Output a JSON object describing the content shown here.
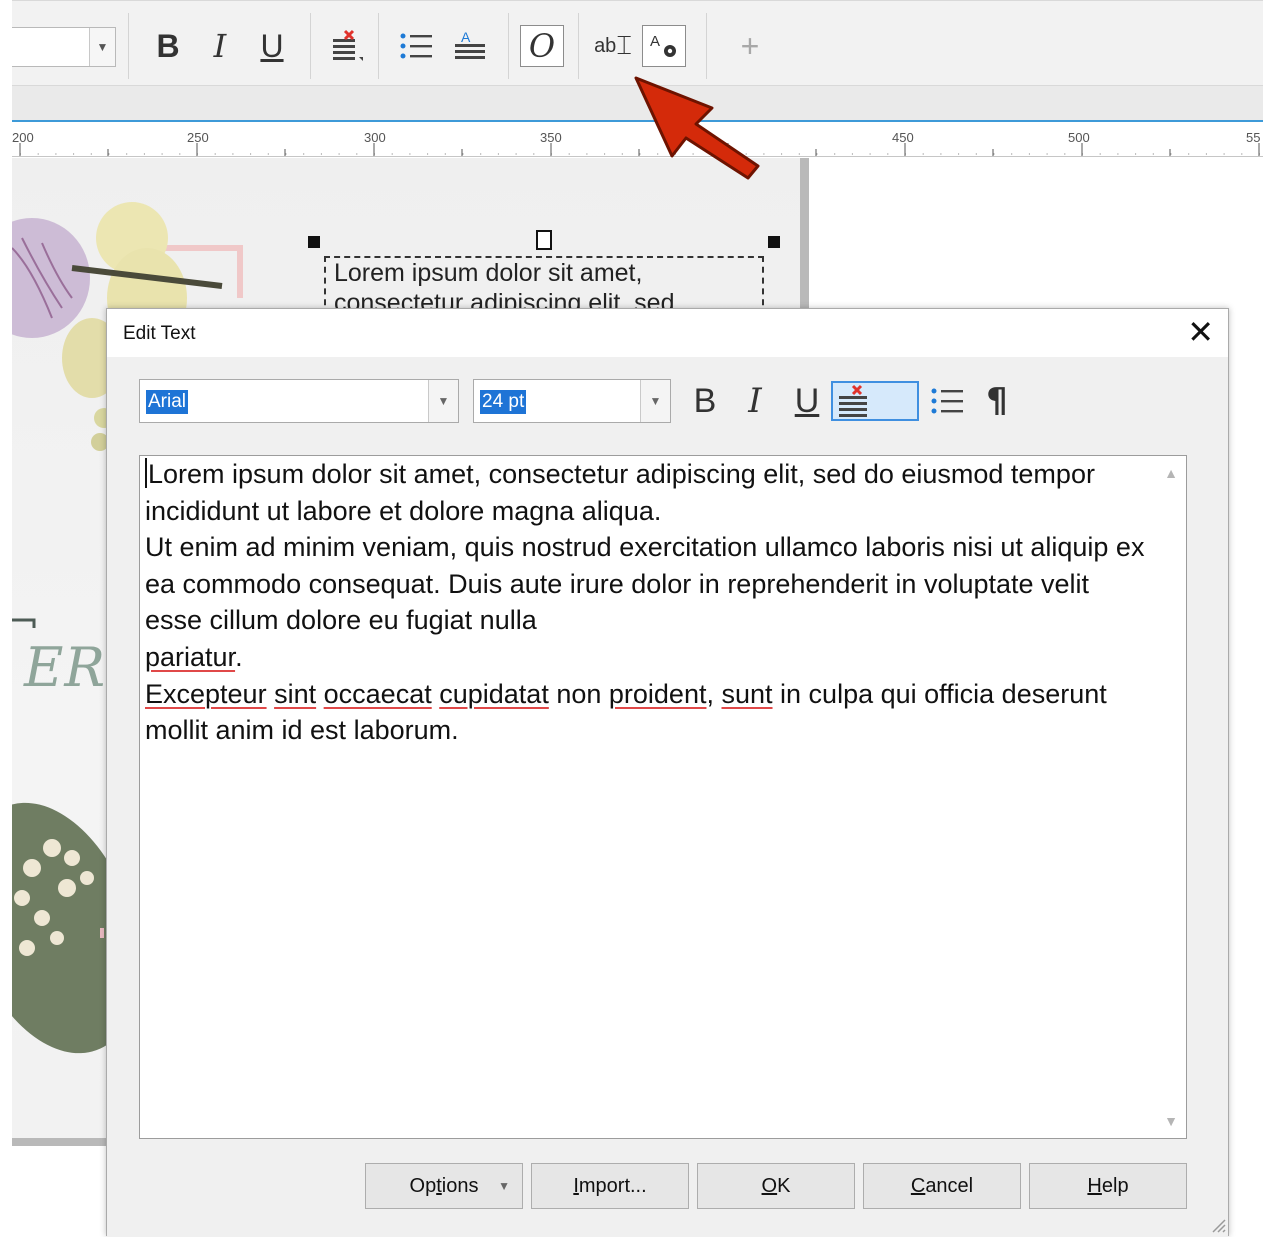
{
  "toolbar": {
    "font_combo_value": "",
    "bold_label": "B",
    "italic_label": "I",
    "underline_label": "U",
    "italic_style_label": "O",
    "text_tool_label": "ab",
    "text_settings_label": "A",
    "add_label": "+",
    "icons": [
      "chevron-down-icon",
      "clear-format-icon",
      "bullet-list-icon",
      "text-highlight-icon",
      "italic-style-icon",
      "edit-text-icon",
      "text-properties-icon",
      "plus-icon"
    ]
  },
  "ruler": {
    "labels": [
      "200",
      "250",
      "300",
      "350",
      "450",
      "500",
      "55"
    ]
  },
  "canvas": {
    "decorative_text": "ER",
    "frame_text": "Lorem ipsum dolor sit amet, consectetur adipiscing elit, sed"
  },
  "annotation": {
    "arrow_color": "#cc2200"
  },
  "dialog": {
    "title": "Edit Text",
    "close_label": "✕",
    "font_value": "Arial",
    "size_value": "24 pt",
    "bold_label": "B",
    "italic_label": "I",
    "underline_label": "U",
    "paragraph_label": "¶",
    "text": {
      "para1": "Lorem ipsum dolor sit amet, consectetur adipiscing elit, sed do eiusmod tempor incididunt ut labore et dolore magna aliqua.",
      "para2": "Ut enim ad minim veniam, quis nostrud exercitation ullamco laboris nisi ut aliquip ex ea commodo consequat. Duis aute irure dolor in reprehenderit in voluptate velit esse cillum dolore eu fugiat nulla",
      "para2_last": "pariatur",
      "para2_end": ".",
      "para3": {
        "w1": "Excepteur",
        "s1": " ",
        "w2": "sint",
        "s2": " ",
        "w3": "occaecat",
        "s3": " ",
        "w4": "cupidatat",
        "s4": " non ",
        "w5": "proident",
        "s5": ", ",
        "w6": "sunt",
        "s6": " in culpa qui officia deserunt mollit anim id est laborum."
      }
    },
    "buttons": {
      "options_pre": "Op",
      "options_ul": "t",
      "options_post": "ions",
      "import_ul": "I",
      "import_post": "mport...",
      "ok_ul": "O",
      "ok_post": "K",
      "cancel_ul": "C",
      "cancel_post": "ancel",
      "help_ul": "H",
      "help_post": "elp"
    },
    "accent_color": "#1e74d6"
  }
}
